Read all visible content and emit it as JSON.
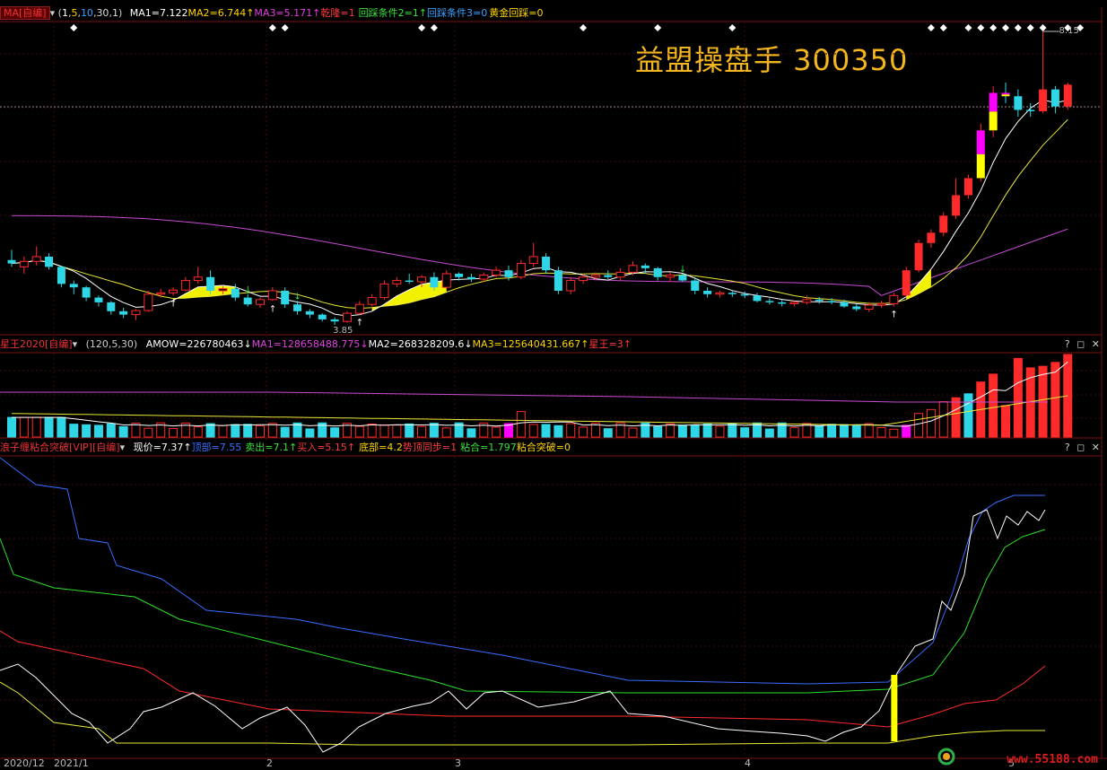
{
  "watermark_title": "益盟操盘手  300350",
  "site_logo": "www.55188.com",
  "panel1": {
    "tag": "MA[自编]",
    "params_open": "(",
    "p1": "1",
    "p2": "5",
    "p3": "10",
    "p4": "30",
    "p5": "1",
    "params_close": ")",
    "ma1": "MA1=7.122",
    "ma2": "MA2=6.744↑",
    "ma3": "MA3=5.171↑",
    "qianlong": "乾隆=1",
    "cond2": "回踩条件2=1↑",
    "cond3": "回踩条件3=0",
    "gold": "黄金回踩=0",
    "high_label": "8.15",
    "low_label": "3.85"
  },
  "panel2": {
    "tag": "星王2020[自编]",
    "params": "(120,5,30)",
    "amow": "AMOW=226780463↓",
    "ma1": "MA1=128658488.775↓",
    "ma2": "MA2=268328209.6↓",
    "ma3": "MA3=125640431.667↑",
    "xingwang": "星王=3↑",
    "controls": "? ◻ ✕"
  },
  "panel3": {
    "tag": "浪子缠粘合突破[VIP][自编]",
    "now": "现价=7.37↑",
    "top": "顶部=7.55",
    "sell": "卖出=7.1↑",
    "buy": "买入=5.15↑",
    "bottom": "底部=4.2",
    "sync": "势顶同步=1",
    "stick": "粘合=1.797",
    "break": "粘合突破=0",
    "controls": "? ◻ ✕"
  },
  "date_axis": [
    "2020/12",
    "2021/1",
    "2",
    "3",
    "4",
    "5"
  ],
  "colors": {
    "up": "#ff2a2a",
    "down": "#2fd6e6",
    "ma_white": "#ffffff",
    "ma_yellow": "#e8e83a",
    "ma_magenta": "#c84bd2",
    "zone_yellow": "#ffff00",
    "zone_magenta": "#ff00ff"
  },
  "chart_data": {
    "type": "candlestick",
    "title": "",
    "y_high_label": 8.15,
    "y_low_label": 3.85,
    "candles": [
      {
        "o": 4.8,
        "h": 4.95,
        "l": 4.7,
        "c": 4.75
      },
      {
        "o": 4.7,
        "h": 4.85,
        "l": 4.6,
        "c": 4.78
      },
      {
        "o": 4.78,
        "h": 5.0,
        "l": 4.72,
        "c": 4.85
      },
      {
        "o": 4.85,
        "h": 4.9,
        "l": 4.66,
        "c": 4.7
      },
      {
        "o": 4.7,
        "h": 4.72,
        "l": 4.4,
        "c": 4.45
      },
      {
        "o": 4.45,
        "h": 4.5,
        "l": 4.3,
        "c": 4.4
      },
      {
        "o": 4.4,
        "h": 4.42,
        "l": 4.2,
        "c": 4.25
      },
      {
        "o": 4.25,
        "h": 4.28,
        "l": 4.12,
        "c": 4.18
      },
      {
        "o": 4.18,
        "h": 4.2,
        "l": 4.0,
        "c": 4.05
      },
      {
        "o": 4.05,
        "h": 4.1,
        "l": 3.95,
        "c": 4.0
      },
      {
        "o": 4.0,
        "h": 4.08,
        "l": 3.92,
        "c": 4.06
      },
      {
        "o": 4.06,
        "h": 4.35,
        "l": 4.04,
        "c": 4.3
      },
      {
        "o": 4.3,
        "h": 4.38,
        "l": 4.25,
        "c": 4.32
      },
      {
        "o": 4.32,
        "h": 4.4,
        "l": 4.28,
        "c": 4.36
      },
      {
        "o": 4.36,
        "h": 4.55,
        "l": 4.34,
        "c": 4.5
      },
      {
        "o": 4.5,
        "h": 4.7,
        "l": 4.45,
        "c": 4.55
      },
      {
        "o": 4.55,
        "h": 4.65,
        "l": 4.3,
        "c": 4.35
      },
      {
        "o": 4.35,
        "h": 4.42,
        "l": 4.3,
        "c": 4.38
      },
      {
        "o": 4.38,
        "h": 4.45,
        "l": 4.2,
        "c": 4.25
      },
      {
        "o": 4.25,
        "h": 4.3,
        "l": 4.12,
        "c": 4.15
      },
      {
        "o": 4.15,
        "h": 4.25,
        "l": 4.1,
        "c": 4.22
      },
      {
        "o": 4.22,
        "h": 4.4,
        "l": 4.2,
        "c": 4.35
      },
      {
        "o": 4.35,
        "h": 4.4,
        "l": 4.1,
        "c": 4.15
      },
      {
        "o": 4.15,
        "h": 4.2,
        "l": 4.0,
        "c": 4.05
      },
      {
        "o": 4.05,
        "h": 4.08,
        "l": 3.95,
        "c": 4.0
      },
      {
        "o": 4.0,
        "h": 4.02,
        "l": 3.9,
        "c": 3.93
      },
      {
        "o": 3.93,
        "h": 3.96,
        "l": 3.85,
        "c": 3.9
      },
      {
        "o": 3.9,
        "h": 4.05,
        "l": 3.88,
        "c": 4.02
      },
      {
        "o": 4.02,
        "h": 4.2,
        "l": 4.0,
        "c": 4.15
      },
      {
        "o": 4.15,
        "h": 4.3,
        "l": 4.12,
        "c": 4.25
      },
      {
        "o": 4.25,
        "h": 4.5,
        "l": 4.22,
        "c": 4.45
      },
      {
        "o": 4.45,
        "h": 4.55,
        "l": 4.4,
        "c": 4.5
      },
      {
        "o": 4.5,
        "h": 4.6,
        "l": 4.45,
        "c": 4.48
      },
      {
        "o": 4.48,
        "h": 4.58,
        "l": 4.4,
        "c": 4.55
      },
      {
        "o": 4.55,
        "h": 4.62,
        "l": 4.35,
        "c": 4.4
      },
      {
        "o": 4.4,
        "h": 4.65,
        "l": 4.38,
        "c": 4.6
      },
      {
        "o": 4.6,
        "h": 4.62,
        "l": 4.5,
        "c": 4.55
      },
      {
        "o": 4.55,
        "h": 4.6,
        "l": 4.48,
        "c": 4.52
      },
      {
        "o": 4.52,
        "h": 4.62,
        "l": 4.48,
        "c": 4.58
      },
      {
        "o": 4.58,
        "h": 4.7,
        "l": 4.55,
        "c": 4.65
      },
      {
        "o": 4.65,
        "h": 4.72,
        "l": 4.5,
        "c": 4.55
      },
      {
        "o": 4.55,
        "h": 4.8,
        "l": 4.52,
        "c": 4.75
      },
      {
        "o": 4.75,
        "h": 5.05,
        "l": 4.7,
        "c": 4.85
      },
      {
        "o": 4.85,
        "h": 4.9,
        "l": 4.6,
        "c": 4.65
      },
      {
        "o": 4.65,
        "h": 4.7,
        "l": 4.3,
        "c": 4.35
      },
      {
        "o": 4.35,
        "h": 4.55,
        "l": 4.3,
        "c": 4.5
      },
      {
        "o": 4.5,
        "h": 4.6,
        "l": 4.45,
        "c": 4.55
      },
      {
        "o": 4.55,
        "h": 4.62,
        "l": 4.5,
        "c": 4.58
      },
      {
        "o": 4.58,
        "h": 4.65,
        "l": 4.52,
        "c": 4.55
      },
      {
        "o": 4.55,
        "h": 4.68,
        "l": 4.5,
        "c": 4.62
      },
      {
        "o": 4.62,
        "h": 4.78,
        "l": 4.58,
        "c": 4.72
      },
      {
        "o": 4.72,
        "h": 4.75,
        "l": 4.6,
        "c": 4.68
      },
      {
        "o": 4.68,
        "h": 4.7,
        "l": 4.5,
        "c": 4.55
      },
      {
        "o": 4.55,
        "h": 4.62,
        "l": 4.48,
        "c": 4.58
      },
      {
        "o": 4.58,
        "h": 4.6,
        "l": 4.48,
        "c": 4.5
      },
      {
        "o": 4.5,
        "h": 4.55,
        "l": 4.3,
        "c": 4.35
      },
      {
        "o": 4.35,
        "h": 4.4,
        "l": 4.25,
        "c": 4.3
      },
      {
        "o": 4.3,
        "h": 4.35,
        "l": 4.25,
        "c": 4.32
      },
      {
        "o": 4.32,
        "h": 4.36,
        "l": 4.26,
        "c": 4.3
      },
      {
        "o": 4.3,
        "h": 4.34,
        "l": 4.24,
        "c": 4.28
      },
      {
        "o": 4.28,
        "h": 4.32,
        "l": 4.18,
        "c": 4.2
      },
      {
        "o": 4.2,
        "h": 4.24,
        "l": 4.15,
        "c": 4.18
      },
      {
        "o": 4.18,
        "h": 4.22,
        "l": 4.12,
        "c": 4.16
      },
      {
        "o": 4.16,
        "h": 4.2,
        "l": 4.12,
        "c": 4.18
      },
      {
        "o": 4.18,
        "h": 4.28,
        "l": 4.15,
        "c": 4.22
      },
      {
        "o": 4.22,
        "h": 4.26,
        "l": 4.16,
        "c": 4.2
      },
      {
        "o": 4.2,
        "h": 4.24,
        "l": 4.15,
        "c": 4.18
      },
      {
        "o": 4.18,
        "h": 4.22,
        "l": 4.1,
        "c": 4.12
      },
      {
        "o": 4.12,
        "h": 4.16,
        "l": 4.05,
        "c": 4.08
      },
      {
        "o": 4.08,
        "h": 4.18,
        "l": 4.04,
        "c": 4.14
      },
      {
        "o": 4.14,
        "h": 4.2,
        "l": 4.1,
        "c": 4.16
      },
      {
        "o": 4.16,
        "h": 4.32,
        "l": 4.12,
        "c": 4.28
      },
      {
        "o": 4.28,
        "h": 4.7,
        "l": 4.26,
        "c": 4.65
      },
      {
        "o": 4.65,
        "h": 5.1,
        "l": 4.62,
        "c": 5.05
      },
      {
        "o": 5.05,
        "h": 5.25,
        "l": 4.98,
        "c": 5.2
      },
      {
        "o": 5.2,
        "h": 5.5,
        "l": 5.15,
        "c": 5.45
      },
      {
        "o": 5.45,
        "h": 6.0,
        "l": 5.4,
        "c": 5.75
      },
      {
        "o": 5.75,
        "h": 6.05,
        "l": 5.7,
        "c": 6.0
      },
      {
        "o": 6.0,
        "h": 6.8,
        "l": 5.95,
        "c": 6.7
      },
      {
        "o": 6.7,
        "h": 7.35,
        "l": 6.6,
        "c": 7.25
      },
      {
        "o": 7.25,
        "h": 7.4,
        "l": 7.1,
        "c": 7.2
      },
      {
        "o": 7.2,
        "h": 7.3,
        "l": 6.9,
        "c": 7.0
      },
      {
        "o": 7.0,
        "h": 7.1,
        "l": 6.9,
        "c": 6.98
      },
      {
        "o": 6.98,
        "h": 8.15,
        "l": 6.95,
        "c": 7.3
      },
      {
        "o": 7.3,
        "h": 7.35,
        "l": 6.95,
        "c": 7.05
      },
      {
        "o": 7.05,
        "h": 7.4,
        "l": 7.0,
        "c": 7.37
      }
    ],
    "volume_flags": [
      0,
      0,
      0,
      0,
      0,
      0,
      0,
      0,
      0,
      0,
      0,
      0,
      0,
      0,
      0,
      0,
      0,
      0,
      0,
      0,
      0,
      0,
      0,
      0,
      0,
      0,
      0,
      0,
      0,
      0,
      0,
      0,
      0,
      0,
      0,
      0,
      0,
      0,
      0,
      0,
      0,
      1,
      0,
      0,
      0,
      0,
      0,
      0,
      0,
      0,
      0,
      0,
      0,
      0,
      0,
      0,
      0,
      0,
      0,
      0,
      0,
      0,
      0,
      0,
      0,
      0,
      0,
      0,
      0,
      0,
      0,
      1,
      0,
      0,
      0,
      0,
      0,
      0,
      0,
      0,
      0,
      0,
      0,
      0,
      0,
      0
    ]
  }
}
